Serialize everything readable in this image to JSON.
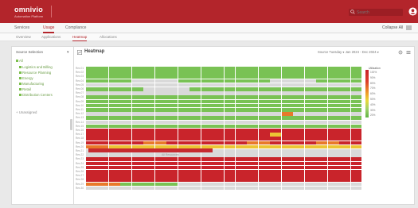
{
  "header": {
    "brand": "omnivio",
    "brand_sub": "Automation Platform",
    "search_placeholder": "Search",
    "colors": {
      "bar": "#b3252b",
      "accent": "#b3252b"
    }
  },
  "nav": {
    "tabs": [
      {
        "label": "Services",
        "active": false
      },
      {
        "label": "Usage",
        "active": true
      },
      {
        "label": "Compliance",
        "active": false
      }
    ],
    "right_label": "Collapse All"
  },
  "subnav": {
    "tabs": [
      {
        "label": "Overview",
        "active": false
      },
      {
        "label": "Applications",
        "active": false
      },
      {
        "label": "Heatmap",
        "active": true
      },
      {
        "label": "Allocations",
        "active": false
      }
    ]
  },
  "sidebar": {
    "title": "Source Selection",
    "items": [
      {
        "label": "All",
        "level": 0
      },
      {
        "label": "Logistics and Billing",
        "level": 1
      },
      {
        "label": "Resource Planning",
        "level": 1
      },
      {
        "label": "Energy",
        "level": 1
      },
      {
        "label": "Manufacturing",
        "level": 1
      },
      {
        "label": "Retail",
        "level": 1
      },
      {
        "label": "Distribution Centers",
        "level": 1
      },
      {
        "label": "Unassigned",
        "level": 0
      }
    ]
  },
  "panel": {
    "title": "Heatmap",
    "toolbar": "Source  Tuesday  ▾    Jan 2024 - Dec 2024  ▾",
    "legend_title": "Utilization",
    "legend_labels": [
      "100%",
      "90%",
      "80%",
      "70%",
      "60%",
      "50%",
      "40%",
      "30%",
      "20%"
    ],
    "bottom_label": "All Resources"
  },
  "heatmap": {
    "columns": 24,
    "rows": [
      {
        "label": "Res 01",
        "cells": "GGGGGGGGGGGGGGGGGGGGGGGG"
      },
      {
        "label": "Res 02",
        "cells": "GGGGGGGGGGGGGGGGGGGGGGGG"
      },
      {
        "label": "Res 03",
        "cells": "GGGGGGGGGGGGGGGGGGGGGGGG"
      },
      {
        "label": "Res 04",
        "cells": "GGGGLLLLGGGGGGGGLLLLGGGG"
      },
      {
        "label": "Res 05",
        "cells": "LLLLLLLLLLLLLLLLLLLLLLLL"
      },
      {
        "label": "Res 06",
        "cells": "GGGGGLLLLGGGGGGGGGGGGGGG"
      },
      {
        "label": "Res 07",
        "cells": "LLLLLLLLLLLLLLLLLLLLLLLL"
      },
      {
        "label": "Res 08",
        "cells": "GGGGGGGGGGGGGGGGGGGGGGGG"
      },
      {
        "label": "Res 09",
        "cells": "GGGGGGGGGGGGGGGGGGGGGGGG"
      },
      {
        "label": "Res 10",
        "cells": "GGGGGGGGGGGGGGGGGGGGGGGG"
      },
      {
        "label": "Res 11",
        "cells": "GGGGGGGGGGGGGGGGGGGGGGGG"
      },
      {
        "label": "Res 12",
        "cells": "LLLLLLLLLLLLLLLLLOLLLLLL"
      },
      {
        "label": "Res 13",
        "cells": "GGGGGGGGGGGGGGGGGGGGGGGG"
      },
      {
        "label": "Res 14",
        "cells": "LLLLLLLLLLLLLLLLLLLLLLLL"
      },
      {
        "label": "Res 15",
        "cells": "GGGGGGGGGGGGGGGGGGGGGGGG"
      },
      {
        "label": "Res 16",
        "cells": "RRRRRRRRRRRRRRRRRRRRRRRR"
      },
      {
        "label": "Res 17",
        "cells": "RRRRRRRRRRRRRRRRYRRRRRRR"
      },
      {
        "label": "Res 18",
        "cells": "RRRRRRRRRRRRRRRRRRRRRRRR"
      },
      {
        "label": "Res 19",
        "cells": "RRRRROORRRRRRROORRRROORR"
      },
      {
        "label": "Res 20",
        "cells": "OOYYYYYYYYYYYYYYYYYYYYYY"
      },
      {
        "label": "Res 21",
        "cells": "LLLLLLLLLLLLLLLLLLLLLLLL"
      },
      {
        "label": "Res 22",
        "cells": "LLLLLLLLLLLLLLLLLLLLLLLL"
      },
      {
        "label": "Res 23",
        "cells": "RRRRRRRRRRRRRRRRRRRRRRRR"
      },
      {
        "label": "Res 24",
        "cells": "RRRRRRRRRRRRRRRRRRRRRRRR"
      },
      {
        "label": "Res 25",
        "cells": "RRRRRRRRRRRRRRRRRRRRRRRR"
      },
      {
        "label": "Res 26",
        "cells": "RRRRRRRRRRRRRRRRRRRRRRRR"
      },
      {
        "label": "Res 27",
        "cells": "RRRRRRRRRRRRRRRRRRRRRRRR"
      },
      {
        "label": "Res 28",
        "cells": "RRRRRRRRRRRRRRRRRRRRRRRR"
      },
      {
        "label": "Res 29",
        "cells": "OOOGGGGGLLLLLLLLLLLLLLLL"
      },
      {
        "label": "Res 30",
        "cells": "LLLLLLLLLLLLLLLLLLLLLLLL"
      }
    ],
    "palette": {
      "G": "#79c254",
      "L": "#d9d9d9",
      "R": "#c9242b",
      "O": "#e8792a",
      "Y": "#ecc534"
    }
  }
}
